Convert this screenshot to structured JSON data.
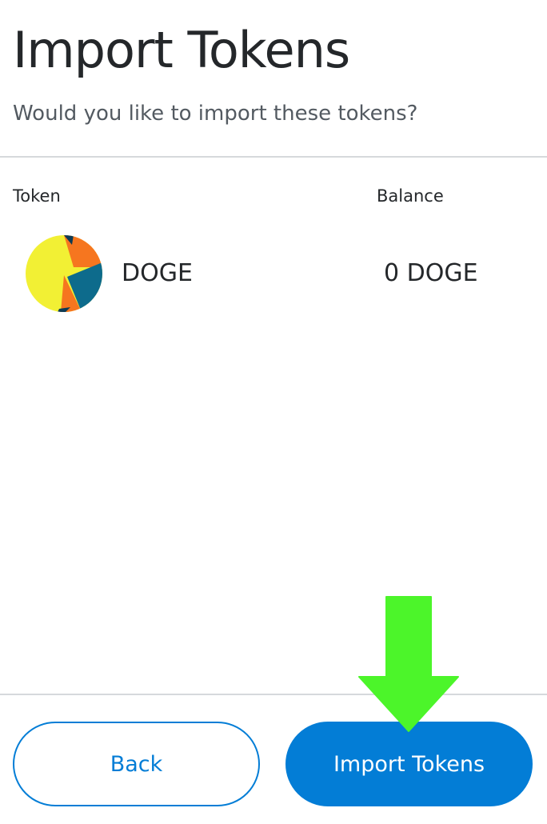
{
  "header": {
    "title": "Import Tokens",
    "subtitle": "Would you like to import these tokens?"
  },
  "table": {
    "columns": [
      "Token",
      "Balance"
    ],
    "rows": [
      {
        "symbol": "DOGE",
        "balance": "0 DOGE",
        "icon": "token-identicon-icon"
      }
    ]
  },
  "footer": {
    "back_label": "Back",
    "import_label": "Import Tokens"
  },
  "colors": {
    "accent": "#037dd6",
    "annotation_arrow": "#4cf52a"
  }
}
